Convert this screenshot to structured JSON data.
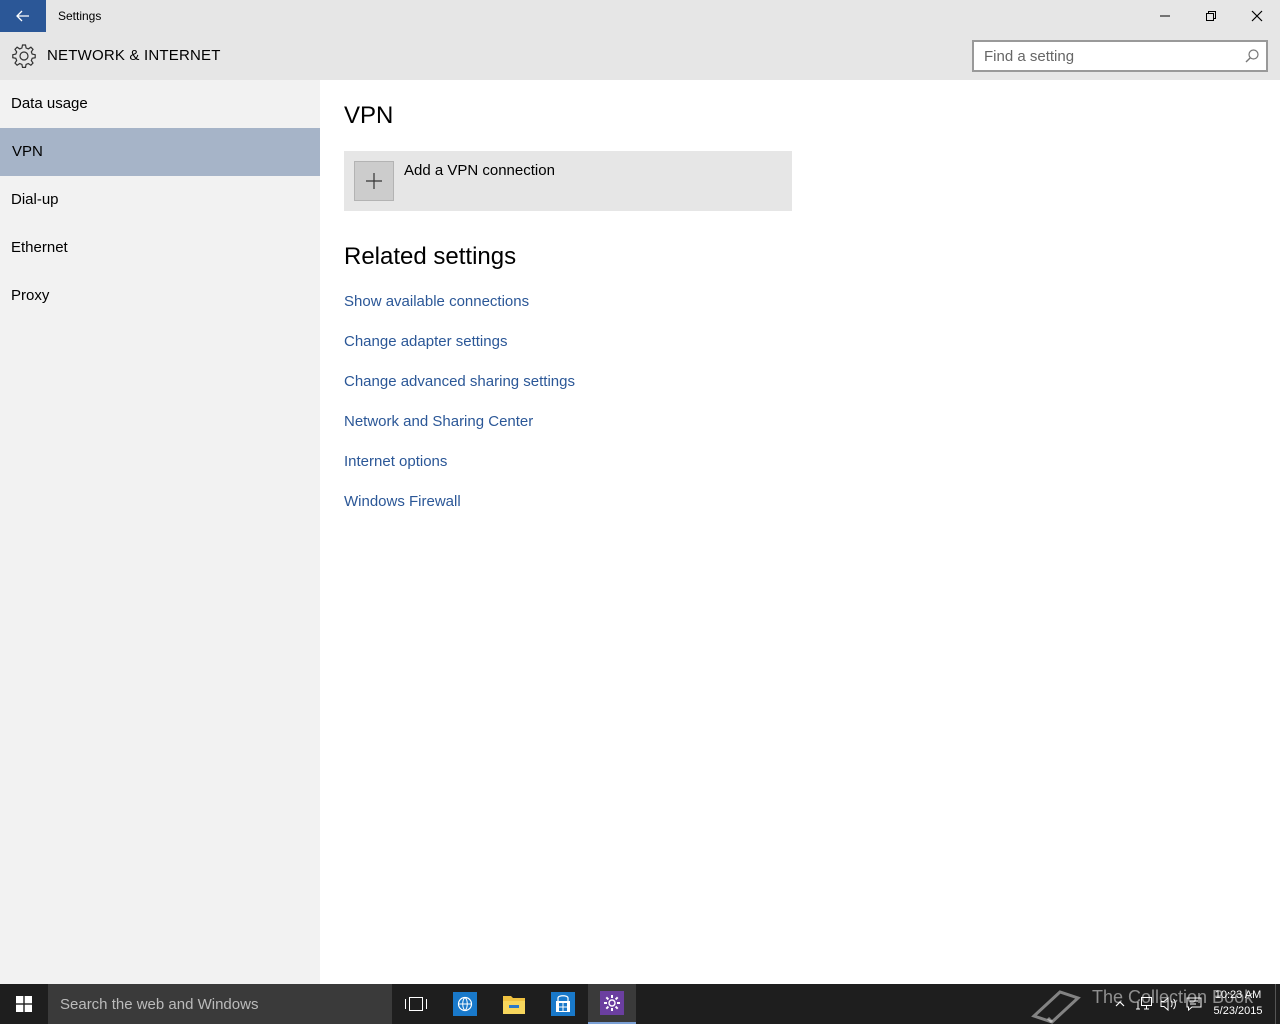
{
  "window": {
    "title": "Settings"
  },
  "header": {
    "section_title": "NETWORK & INTERNET",
    "search_placeholder": "Find a setting"
  },
  "sidebar": {
    "items": [
      {
        "label": "Data usage",
        "selected": false
      },
      {
        "label": "VPN",
        "selected": true
      },
      {
        "label": "Dial-up",
        "selected": false
      },
      {
        "label": "Ethernet",
        "selected": false
      },
      {
        "label": "Proxy",
        "selected": false
      }
    ]
  },
  "main": {
    "heading": "VPN",
    "add_vpn_label": "Add a VPN connection",
    "related_heading": "Related settings",
    "related_links": [
      "Show available connections",
      "Change adapter settings",
      "Change advanced sharing settings",
      "Network and Sharing Center",
      "Internet options",
      "Windows Firewall"
    ]
  },
  "taskbar": {
    "search_placeholder": "Search the web and Windows",
    "watermark": "The Collection Book",
    "time": "10:23 AM",
    "date": "5/23/2015"
  },
  "colors": {
    "accent": "#2b5797",
    "selected_nav": "#a6b4c8",
    "chrome": "#e6e6e6",
    "sidebar": "#f2f2f2",
    "taskbar": "#1e1e1e"
  },
  "icons": [
    "back-arrow-icon",
    "minimize-icon",
    "maximize-icon",
    "close-icon",
    "gear-icon",
    "search-icon",
    "plus-icon",
    "windows-logo-icon",
    "task-view-icon",
    "ie-icon",
    "file-explorer-icon",
    "store-icon",
    "settings-icon",
    "tray-chevron-icon",
    "network-icon",
    "volume-icon",
    "action-center-icon"
  ]
}
